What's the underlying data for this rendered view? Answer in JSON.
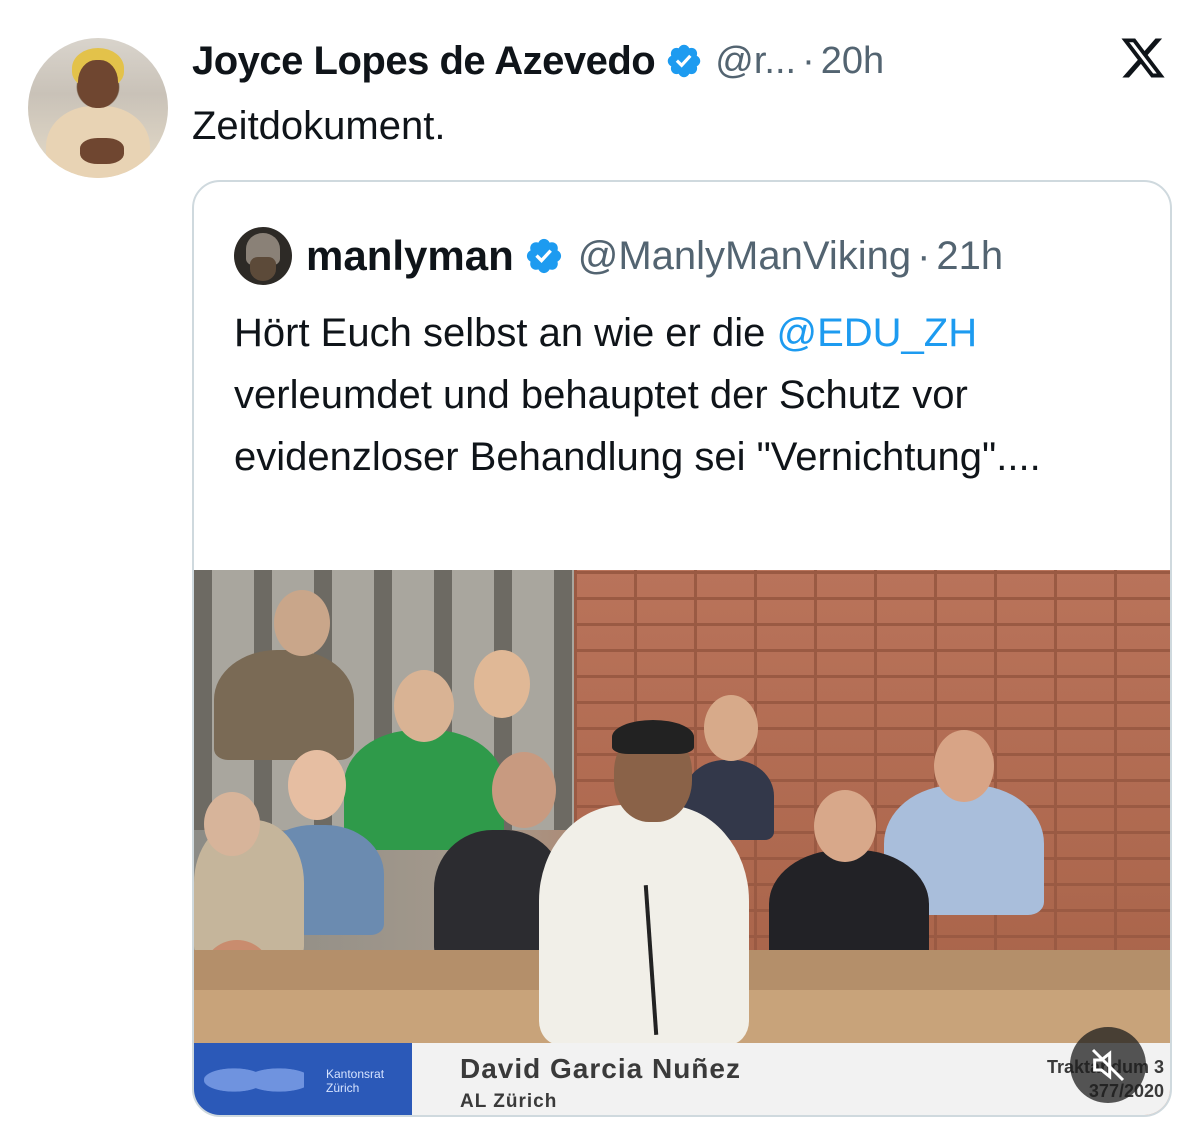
{
  "tweet": {
    "author_name": "Joyce Lopes de Azevedo",
    "author_handle": "@r...",
    "separator": "·",
    "time": "20h",
    "text": "Zeitdokument."
  },
  "quoted_tweet": {
    "author_name": "manlyman",
    "author_handle": "@ManlyManViking",
    "separator": "·",
    "time": "21h",
    "text_before_mention": "Hört Euch selbst an wie er die ",
    "mention": "@EDU_ZH",
    "text_after_mention": " verleumdet und behauptet der Schutz vor evidenzloser Behandlung sei \"Vernichtung\"...."
  },
  "video": {
    "lower_third": {
      "logo_text": "Kantonsrat Zürich",
      "speaker_name": "David Garcia Nuñez",
      "speaker_party_city": "AL   Zürich",
      "traktandum_line1": "Traktandum 3",
      "traktandum_line2": "377/2020"
    },
    "mute_icon": "speaker-muted-icon"
  },
  "colors": {
    "verified_blue": "#1d9bf0",
    "mention_blue": "#1d9bf0",
    "secondary_text": "#536471",
    "lower_third_blue": "#2b59b8"
  },
  "icons": [
    "verified-badge-icon",
    "x-logo-icon",
    "speaker-muted-icon"
  ]
}
